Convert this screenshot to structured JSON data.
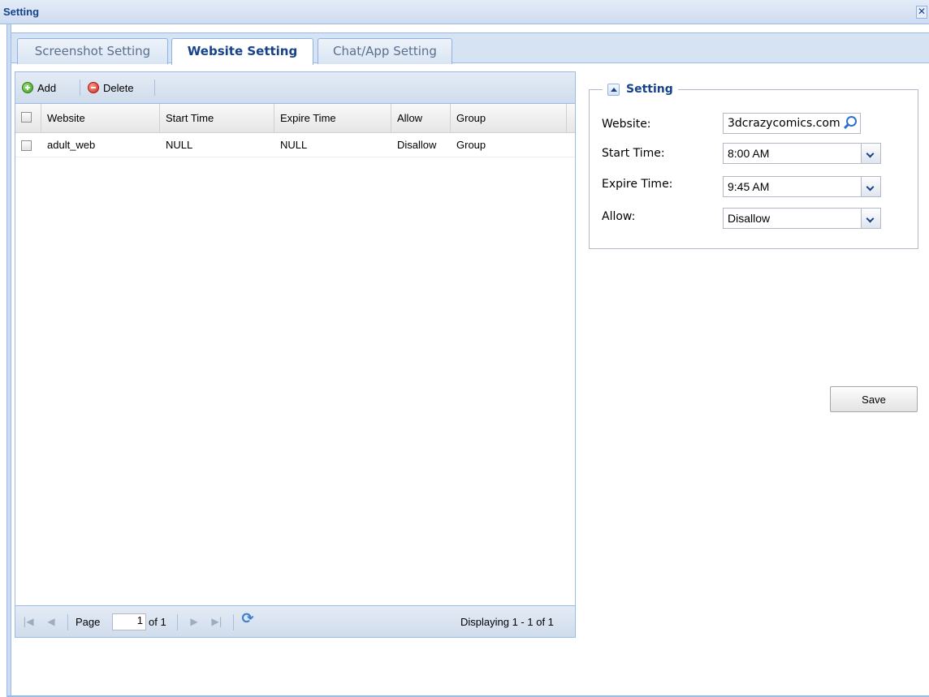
{
  "window": {
    "title": "Setting",
    "close_glyph": "✕"
  },
  "tabs": [
    {
      "label": "Screenshot Setting",
      "active": false
    },
    {
      "label": "Website Setting",
      "active": true
    },
    {
      "label": "Chat/App Setting",
      "active": false
    }
  ],
  "toolbar": {
    "add_label": "Add",
    "delete_label": "Delete"
  },
  "grid": {
    "columns": [
      "Website",
      "Start Time",
      "Expire Time",
      "Allow",
      "Group"
    ],
    "rows": [
      {
        "website": "adult_web",
        "start_time": "NULL",
        "expire_time": "NULL",
        "allow": "Disallow",
        "group": "Group"
      }
    ]
  },
  "paging": {
    "page_label": "Page",
    "page_value": "1",
    "of_text": "of 1",
    "displaying": "Displaying 1 - 1 of 1"
  },
  "setting": {
    "legend": "Setting",
    "website_label": "Website:",
    "website_value": "3dcrazycomics.com",
    "start_label": "Start Time:",
    "start_value": "8:00 AM",
    "expire_label": "Expire Time:",
    "expire_value": "9:45 AM",
    "allow_label": "Allow:",
    "allow_value": "Disallow"
  },
  "save_label": "Save",
  "icons": {
    "add": "add-icon",
    "delete": "delete-icon",
    "search": "search-icon",
    "first_page": "first-page-icon",
    "prev_page": "prev-page-icon",
    "next_page": "next-page-icon",
    "last_page": "last-page-icon",
    "refresh": "refresh-icon",
    "collapse": "collapse-icon",
    "close": "close-icon"
  },
  "colors": {
    "accent": "#15428b",
    "border": "#99bbe8",
    "panel_bg": "#d6e3f2"
  }
}
